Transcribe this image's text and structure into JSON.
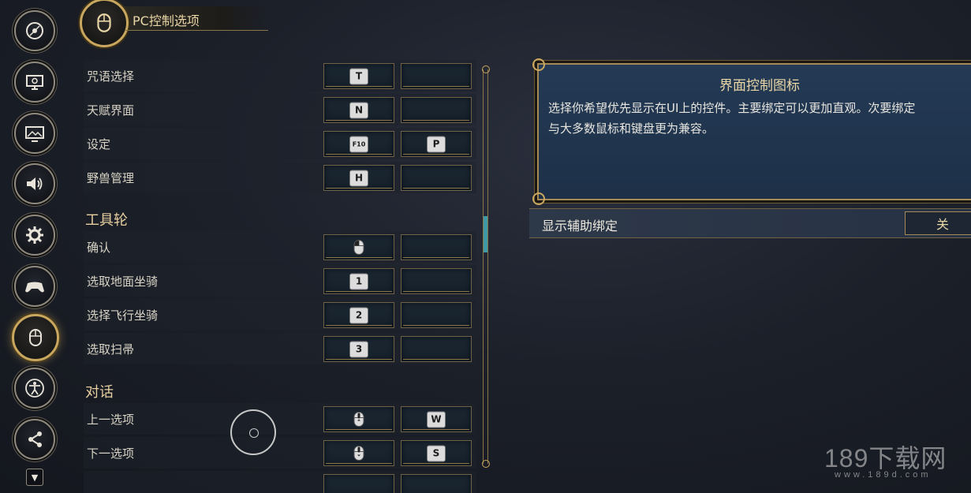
{
  "header": {
    "title": "PC控制选项"
  },
  "sidebar": {
    "items": [
      {
        "name": "disc",
        "icon": "disc-icon"
      },
      {
        "name": "display",
        "icon": "monitor-icon"
      },
      {
        "name": "graphics",
        "icon": "image-monitor-icon"
      },
      {
        "name": "audio",
        "icon": "speaker-icon"
      },
      {
        "name": "settings",
        "icon": "gear-icon"
      },
      {
        "name": "controller",
        "icon": "gamepad-icon"
      },
      {
        "name": "mouse",
        "icon": "mouse-icon",
        "active": true
      },
      {
        "name": "accessibility",
        "icon": "accessibility-icon"
      },
      {
        "name": "share",
        "icon": "share-icon"
      }
    ],
    "small_button_icon": "arrow-down-icon"
  },
  "bindings": {
    "rows": [
      {
        "label": "咒语选择",
        "key1": "T",
        "key2": ""
      },
      {
        "label": "天赋界面",
        "key1": "N",
        "key2": ""
      },
      {
        "label": "设定",
        "key1": "F10",
        "key2": "P"
      },
      {
        "label": "野兽管理",
        "key1": "H",
        "key2": ""
      }
    ],
    "section_tool": "工具轮",
    "tool_rows": [
      {
        "label": "确认",
        "key1": "mouse-left",
        "key2": ""
      },
      {
        "label": "选取地面坐骑",
        "key1": "1",
        "key2": ""
      },
      {
        "label": "选择飞行坐骑",
        "key1": "2",
        "key2": ""
      },
      {
        "label": "选取扫帚",
        "key1": "3",
        "key2": ""
      }
    ],
    "section_dialog": "对话",
    "dialog_rows": [
      {
        "label": "上一选项",
        "key1": "mouse-wheel-up",
        "key2": "W"
      },
      {
        "label": "下一选项",
        "key1": "mouse-wheel-down",
        "key2": "S"
      }
    ]
  },
  "info_panel": {
    "title": "界面控制图标",
    "body_line1": "选择你希望优先显示在UI上的控件。主要绑定可以更加直观。次要绑定",
    "body_line2": "与大多数鼠标和键盘更为兼容。"
  },
  "toggle": {
    "label": "显示辅助绑定",
    "value": "关"
  },
  "watermark": {
    "big": "189下载网",
    "small": "www.189d.com"
  }
}
